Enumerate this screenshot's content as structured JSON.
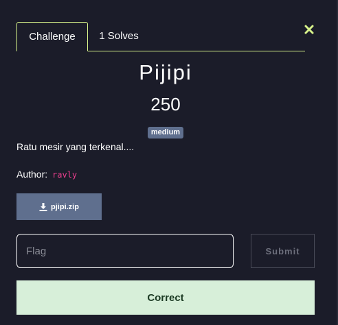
{
  "tabs": [
    {
      "label": "Challenge"
    },
    {
      "label": "1 Solves"
    }
  ],
  "close_icon": "close-icon",
  "challenge": {
    "name": "Pijipi",
    "points": "250",
    "difficulty": "medium",
    "description": "Ratu mesir yang terkenal....",
    "author_label": "Author:",
    "author": "ravly",
    "file_name": "pjipi.zip",
    "file_icon": "download-icon"
  },
  "form": {
    "flag_placeholder": "Flag",
    "flag_value": "",
    "submit_label": "Submit"
  },
  "result": {
    "message": "Correct"
  },
  "colors": {
    "background": "#1b1c29",
    "accent": "#d7f28a",
    "badge": "#5f6f8e",
    "author": "#e83e8c",
    "success_bg": "#d7efd9"
  }
}
